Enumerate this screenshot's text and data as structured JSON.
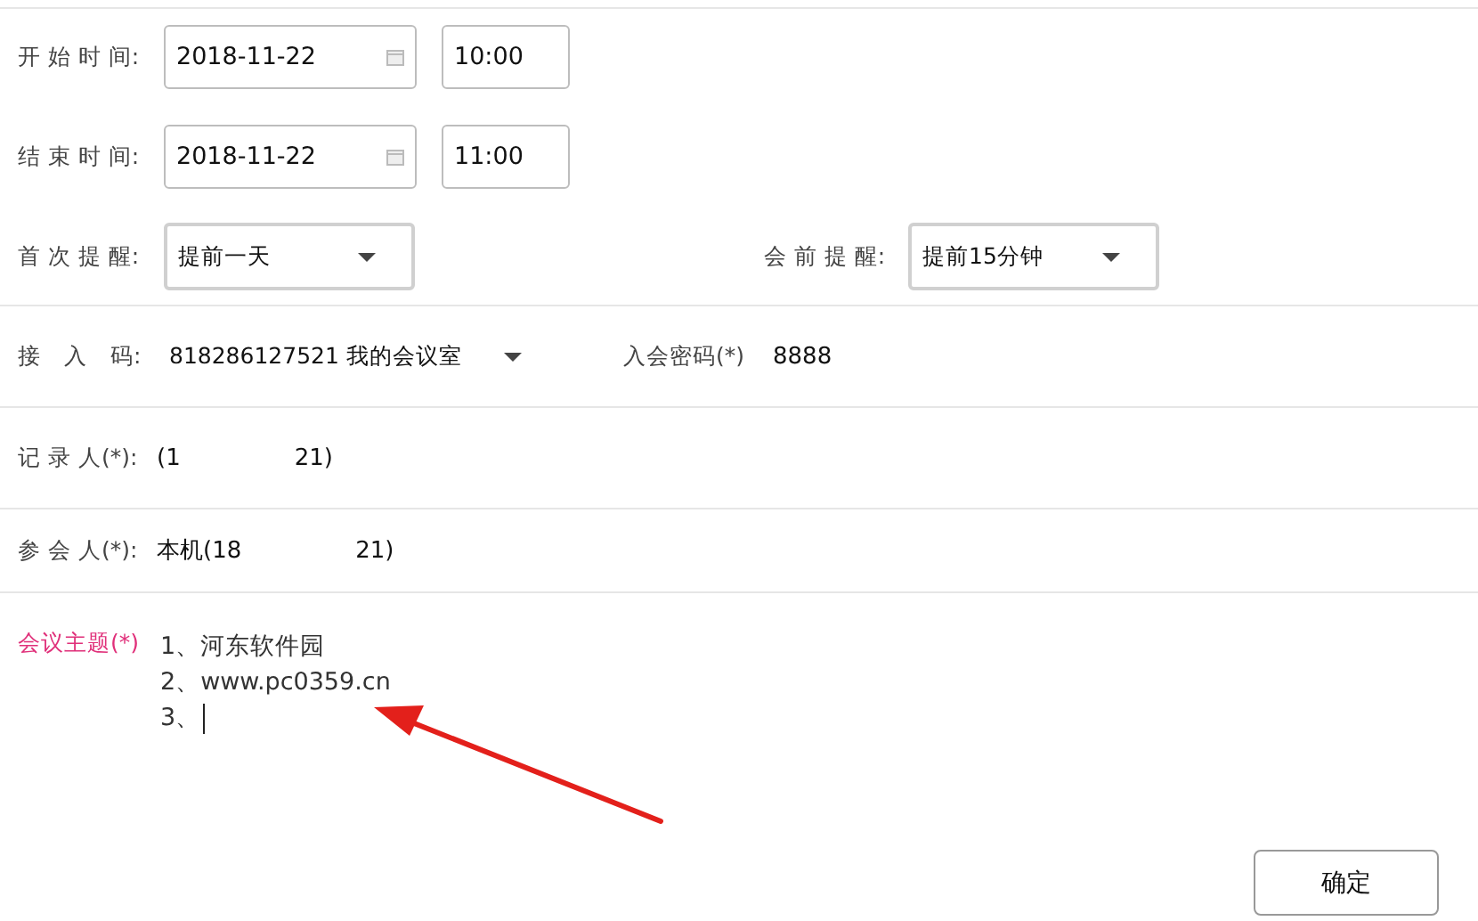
{
  "start_time": {
    "label": "开 始 时 间:",
    "date": "2018-11-22",
    "time": "10:00"
  },
  "end_time": {
    "label": "结 束 时 间:",
    "date": "2018-11-22",
    "time": "11:00"
  },
  "first_reminder": {
    "label": "首 次 提 醒:",
    "value": "提前一天"
  },
  "pre_meeting_reminder": {
    "label": "会 前 提 醒:",
    "value": "提前15分钟"
  },
  "access_code": {
    "label": "接　入　码:",
    "value": "818286127521 我的会议室"
  },
  "meeting_password": {
    "label": "入会密码(*)",
    "value": "8888"
  },
  "recorder": {
    "label": "记 录 人(*):",
    "value_parts": [
      "(1",
      "21)"
    ]
  },
  "participants": {
    "label": "参 会 人(*):",
    "value_parts": [
      "本机(18",
      "21)"
    ]
  },
  "topic": {
    "label": "会议主题(*)",
    "lines": [
      "1、河东软件园",
      "2、www.pc0359.cn",
      "3、"
    ]
  },
  "confirm_button": "确定"
}
